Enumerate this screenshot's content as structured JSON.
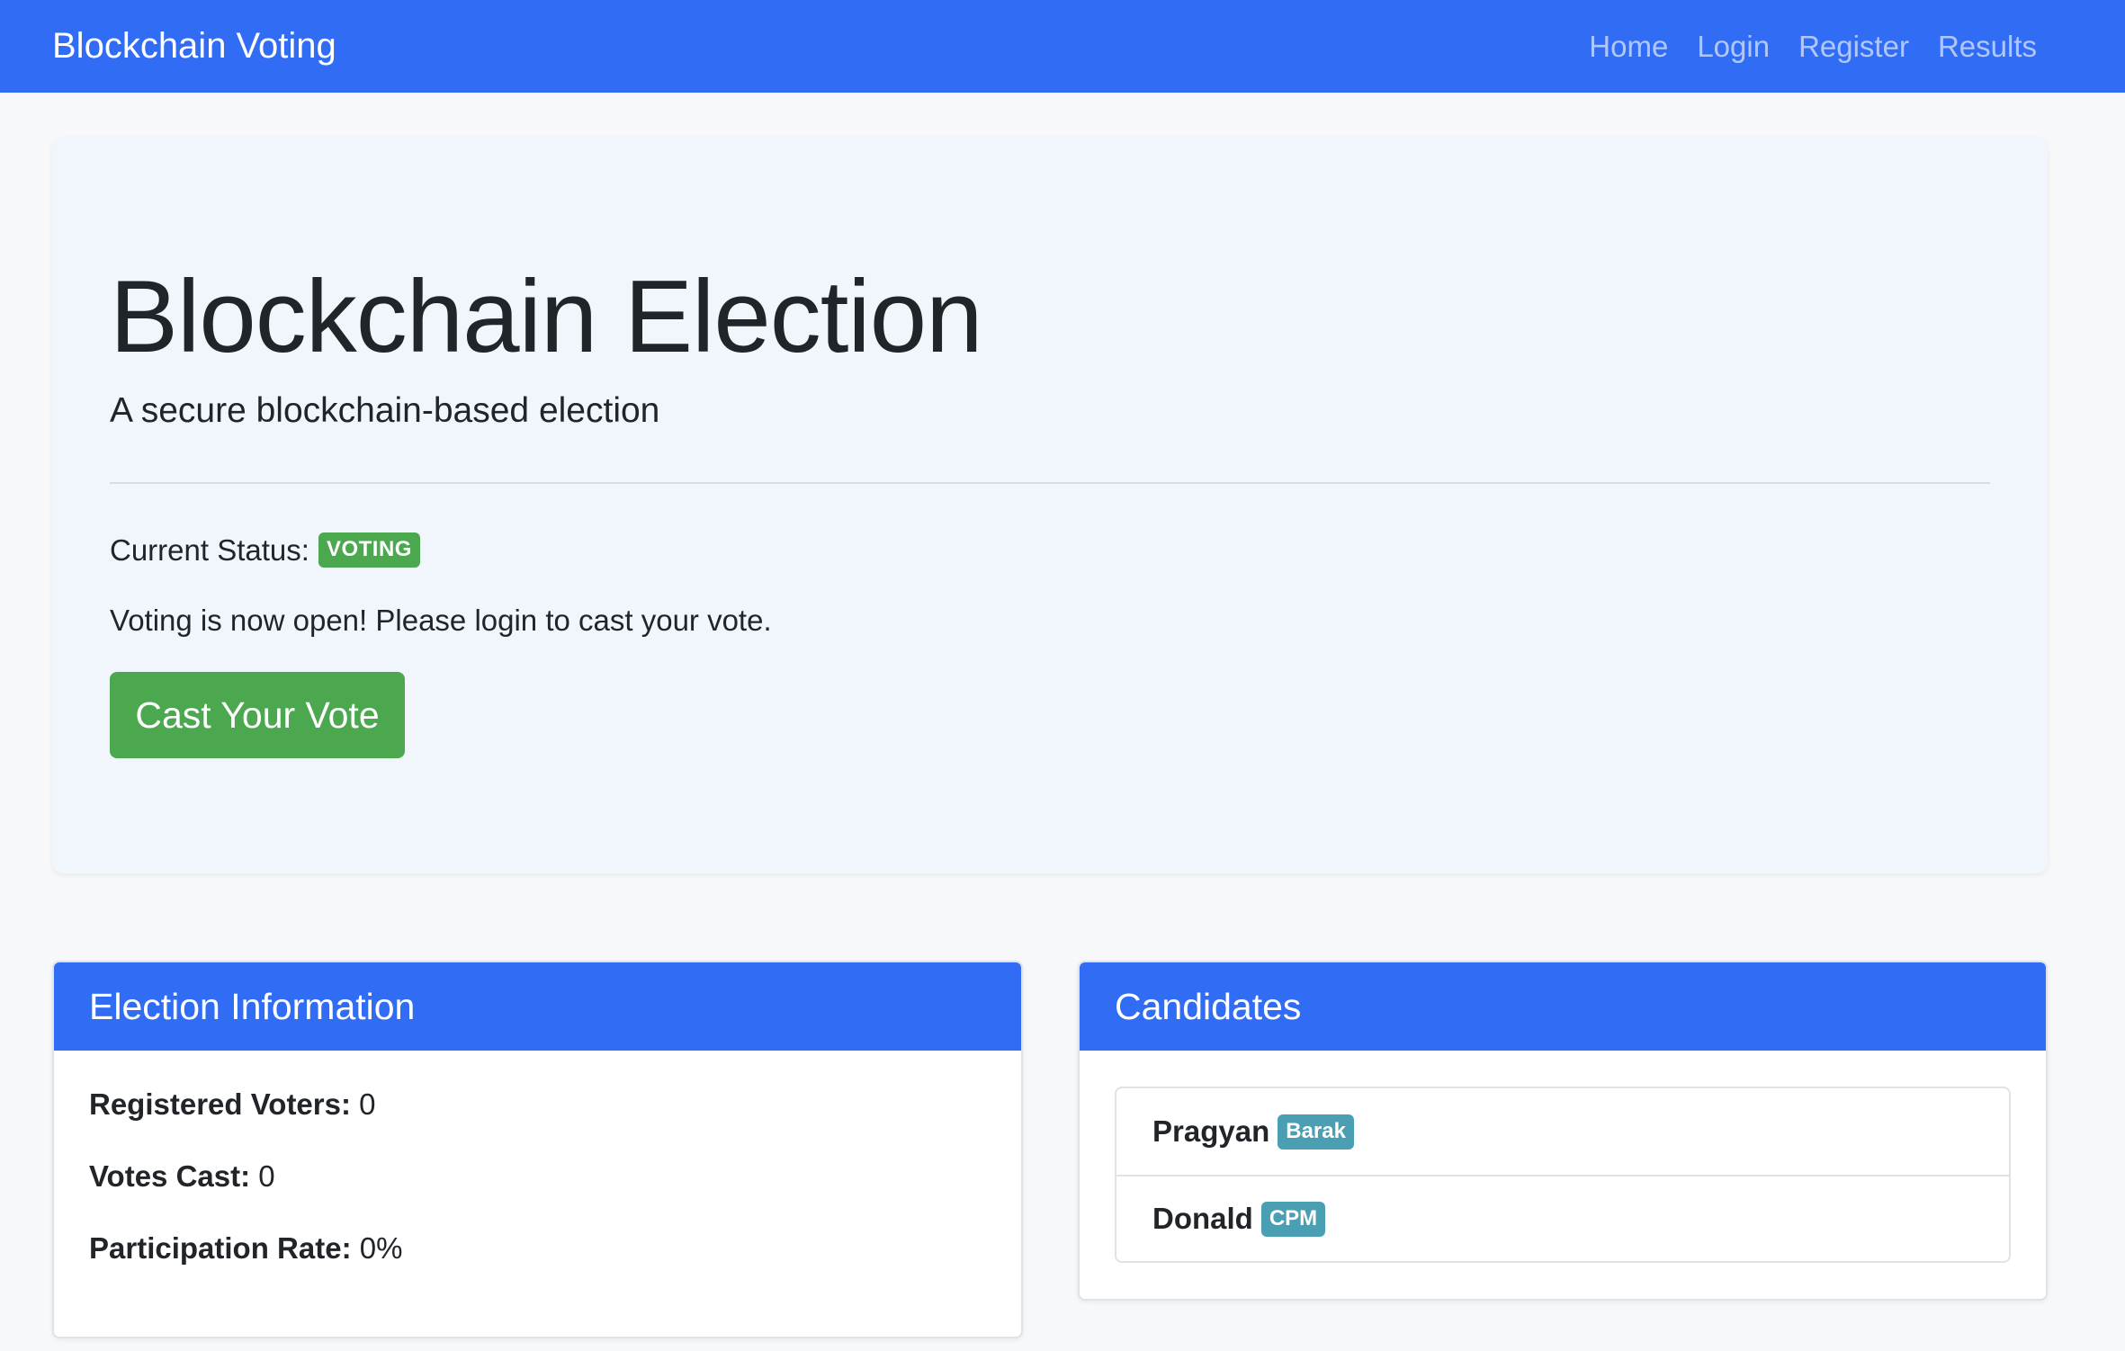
{
  "nav": {
    "brand": "Blockchain Voting",
    "links": [
      "Home",
      "Login",
      "Register",
      "Results"
    ]
  },
  "hero": {
    "title": "Blockchain Election",
    "subtitle": "A secure blockchain-based election",
    "status_label": "Current Status:",
    "status_badge": "VOTING",
    "message": "Voting is now open! Please login to cast your vote.",
    "cta": "Cast Your Vote"
  },
  "election_info": {
    "title": "Election Information",
    "rows": [
      {
        "label": "Registered Voters:",
        "value": "0"
      },
      {
        "label": "Votes Cast:",
        "value": "0"
      },
      {
        "label": "Participation Rate:",
        "value": "0%"
      }
    ]
  },
  "candidates": {
    "title": "Candidates",
    "items": [
      {
        "name": "Pragyan",
        "party": "Barak"
      },
      {
        "name": "Donald",
        "party": "CPM"
      }
    ]
  },
  "colors": {
    "primary": "#316cf4",
    "success": "#4ba84f",
    "info": "#4a9fb3",
    "hero_bg": "#f1f6fc",
    "page_bg": "#f7f8f9"
  }
}
